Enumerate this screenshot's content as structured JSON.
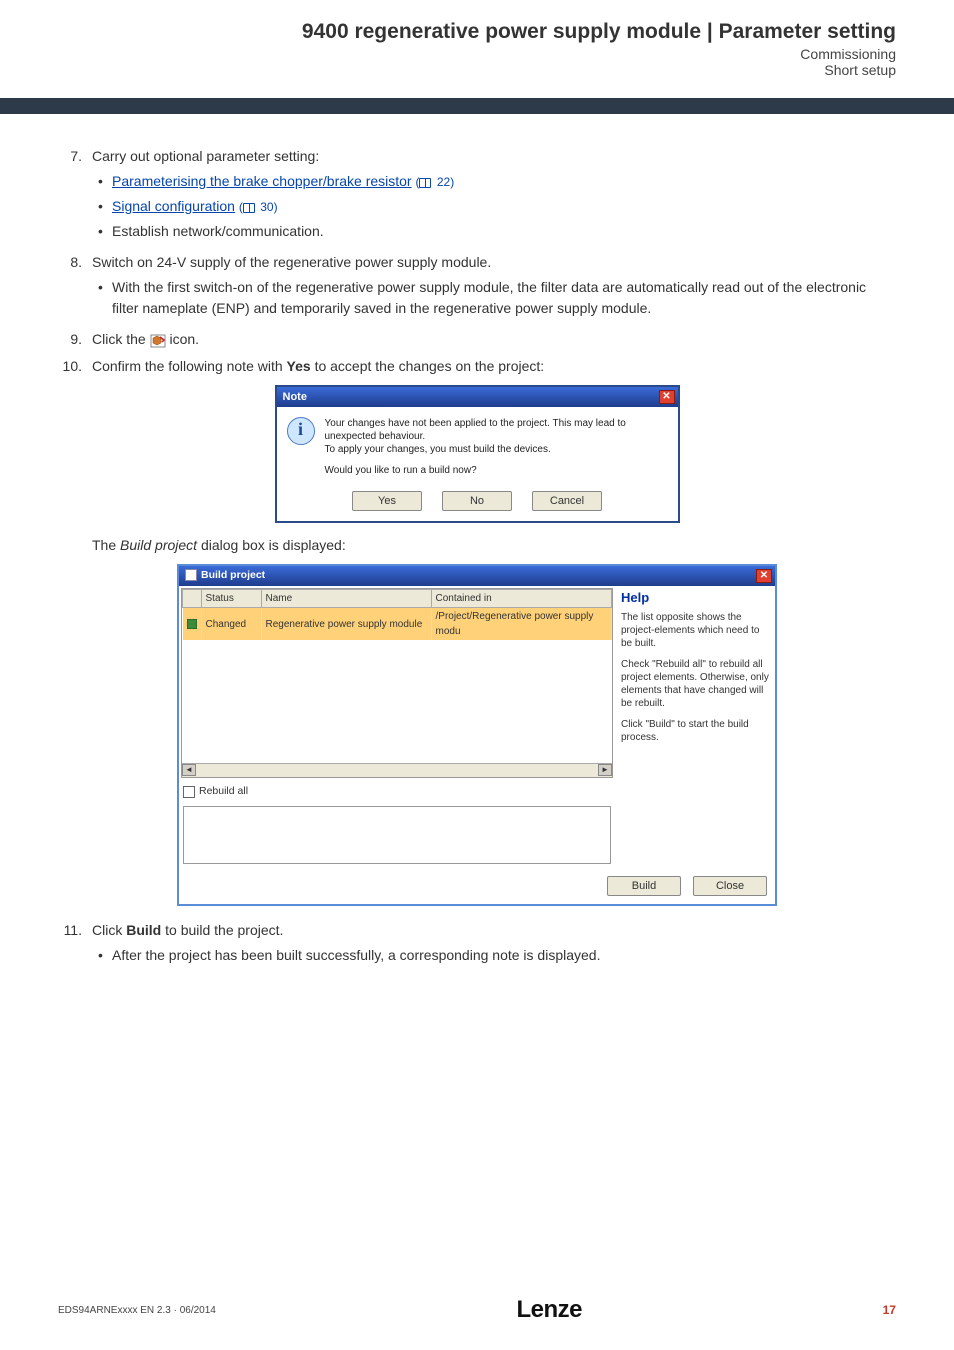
{
  "header": {
    "title": "9400 regenerative power supply module | Parameter setting",
    "sub1": "Commissioning",
    "sub2": "Short setup"
  },
  "steps": {
    "s7": {
      "num": "7.",
      "text": "Carry out optional parameter setting:",
      "bullets": [
        {
          "link": "Parameterising the brake chopper/brake resistor",
          "ref": "22"
        },
        {
          "link": "Signal configuration",
          "ref": "30"
        },
        {
          "plain": "Establish network/communication."
        }
      ]
    },
    "s8": {
      "num": "8.",
      "text": "Switch on 24-V supply of the regenerative power supply module.",
      "bullets": [
        {
          "plain": "With the first switch-on of the regenerative power supply module, the filter data are automatically read out of the electronic filter nameplate (ENP) and temporarily saved in the regenerative power supply module."
        }
      ]
    },
    "s9": {
      "num": "9.",
      "pre": "Click the ",
      "post": " icon."
    },
    "s10": {
      "num": "10.",
      "pre": "Confirm the following note with ",
      "bold": "Yes",
      "post": " to accept the changes on the project:"
    },
    "between": {
      "pre": "The ",
      "italic": "Build project",
      "post": " dialog box is displayed:"
    },
    "s11": {
      "num": "11.",
      "pre": "Click ",
      "bold": "Build",
      "post": " to build the project.",
      "bullets": [
        {
          "plain": "After the project has been built successfully, a corresponding note is displayed."
        }
      ]
    }
  },
  "note_dialog": {
    "title": "Note",
    "line1": "Your changes have not been applied to the project. This may lead to unexpected behaviour.",
    "line2": "To apply your changes, you must build the devices.",
    "line3": "Would you like to run a build now?",
    "yes": "Yes",
    "no": "No",
    "cancel": "Cancel"
  },
  "build_dialog": {
    "title": "Build project",
    "cols": {
      "status": "Status",
      "name": "Name",
      "contained": "Contained in"
    },
    "row": {
      "status": "Changed",
      "name": "Regenerative power supply module",
      "contained": "/Project/Regenerative power supply modu"
    },
    "rebuild_all": "Rebuild all",
    "help": {
      "header": "Help",
      "p1": "The list opposite shows the project-elements which need to be built.",
      "p2": "Check \"Rebuild all\" to rebuild all project elements. Otherwise, only elements that have changed will be rebuilt.",
      "p3": "Click \"Build\" to start the build process."
    },
    "build_btn": "Build",
    "close_btn": "Close"
  },
  "footer": {
    "docid": "EDS94ARNExxxx EN 2.3 · 06/2014",
    "logo": "Lenze",
    "page": "17"
  }
}
